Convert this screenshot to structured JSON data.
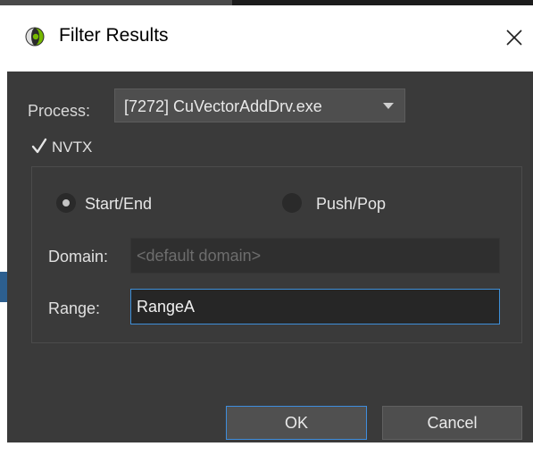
{
  "window": {
    "title": "Filter Results",
    "close_glyph": "✕"
  },
  "process": {
    "label": "Process:",
    "value": "[7272] CuVectorAddDrv.exe"
  },
  "nvtx": {
    "checked": true,
    "check_glyph": "✓",
    "label": "NVTX"
  },
  "mode": {
    "options": [
      {
        "label": "Start/End",
        "selected": true
      },
      {
        "label": "Push/Pop",
        "selected": false
      }
    ]
  },
  "domain": {
    "label": "Domain:",
    "value": "",
    "placeholder": "<default domain>"
  },
  "range": {
    "label": "Range:",
    "value": "RangeA"
  },
  "buttons": {
    "ok": "OK",
    "cancel": "Cancel"
  },
  "colors": {
    "dialog_bg": "#3a3a3a",
    "focus_border": "#3e8fd8",
    "text": "#e0e0e0"
  }
}
